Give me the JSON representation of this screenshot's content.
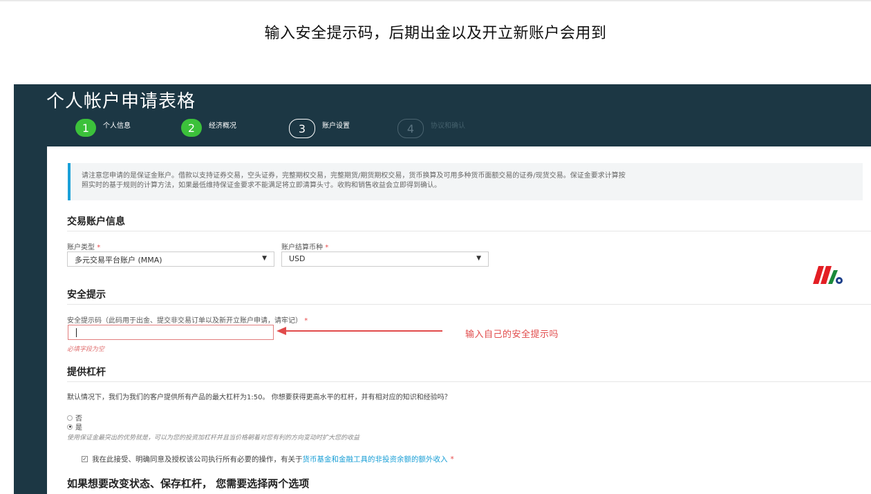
{
  "caption": "输入安全提示码，后期出金以及开立新账户会用到",
  "form": {
    "title": "个人帐户申请表格",
    "steps": [
      {
        "num": "1",
        "label": "个人信息",
        "state": "done"
      },
      {
        "num": "2",
        "label": "经济概况",
        "state": "done"
      },
      {
        "num": "3",
        "label": "账户设置",
        "state": "active"
      },
      {
        "num": "4",
        "label": "协议和确认",
        "state": "pending"
      }
    ],
    "notice": {
      "line1": "请注意您申请的是保证金账户。借款以支持证券交易，空头证券，完整期权交易，完整期货/期货期权交易，货币换算及可用多种货币面额交易的证券/现货交易。保证金要求计算按",
      "line2": "照实时的基于规则的计算方法，如果最低维持保证金要求不能满足将立即清算头寸。收购和销售收益会立即得到确认。"
    },
    "trading_section": {
      "title": "交易账户信息",
      "account_type_label": "账户类型",
      "account_type_value": "多元交易平台账户 (MMA)",
      "currency_label": "账户结算币种",
      "currency_value": "USD",
      "required_mark": "*"
    },
    "security_section": {
      "title": "安全提示",
      "code_label": "安全提示码（此码用于出金、提交非交易订单以及新开立账户申请，请牢记）",
      "required_mark": "*",
      "error": "必填字段为空",
      "annotation": "输入自己的安全提示吗"
    },
    "leverage_section": {
      "title": "提供杠杆",
      "question": "默认情况下，我们为我们的客户提供所有产品的最大杠杆为1:50。 你想要获得更高水平的杠杆，并有相对应的知识和经验吗？",
      "option_no": "否",
      "option_yes": "是",
      "hint": "使用保证金最突出的优势就是，可以为您的投资加杠杆并且当价格朝着对您有利的方向变动时扩大您的收益",
      "consent_prefix": "我在此接受、明确同意及授权该公司执行所有必要的操作，有关于",
      "consent_link": "货币基金和金融工具的非投资余额的额外收入",
      "required_mark": "*"
    },
    "bottom_heading": "如果想要改变状态、保存杠杆， 您需要选择两个选项"
  },
  "colors": {
    "header_bg": "#1c3744",
    "step_done": "#3cc13b",
    "notice_accent": "#1aa0d8",
    "annotation_red": "#e14b4b",
    "link": "#1a9fd6"
  },
  "icons": {
    "logo": "brand-stripes-logo",
    "arrow": "left-arrow-icon",
    "caret": "caret-down-icon"
  }
}
